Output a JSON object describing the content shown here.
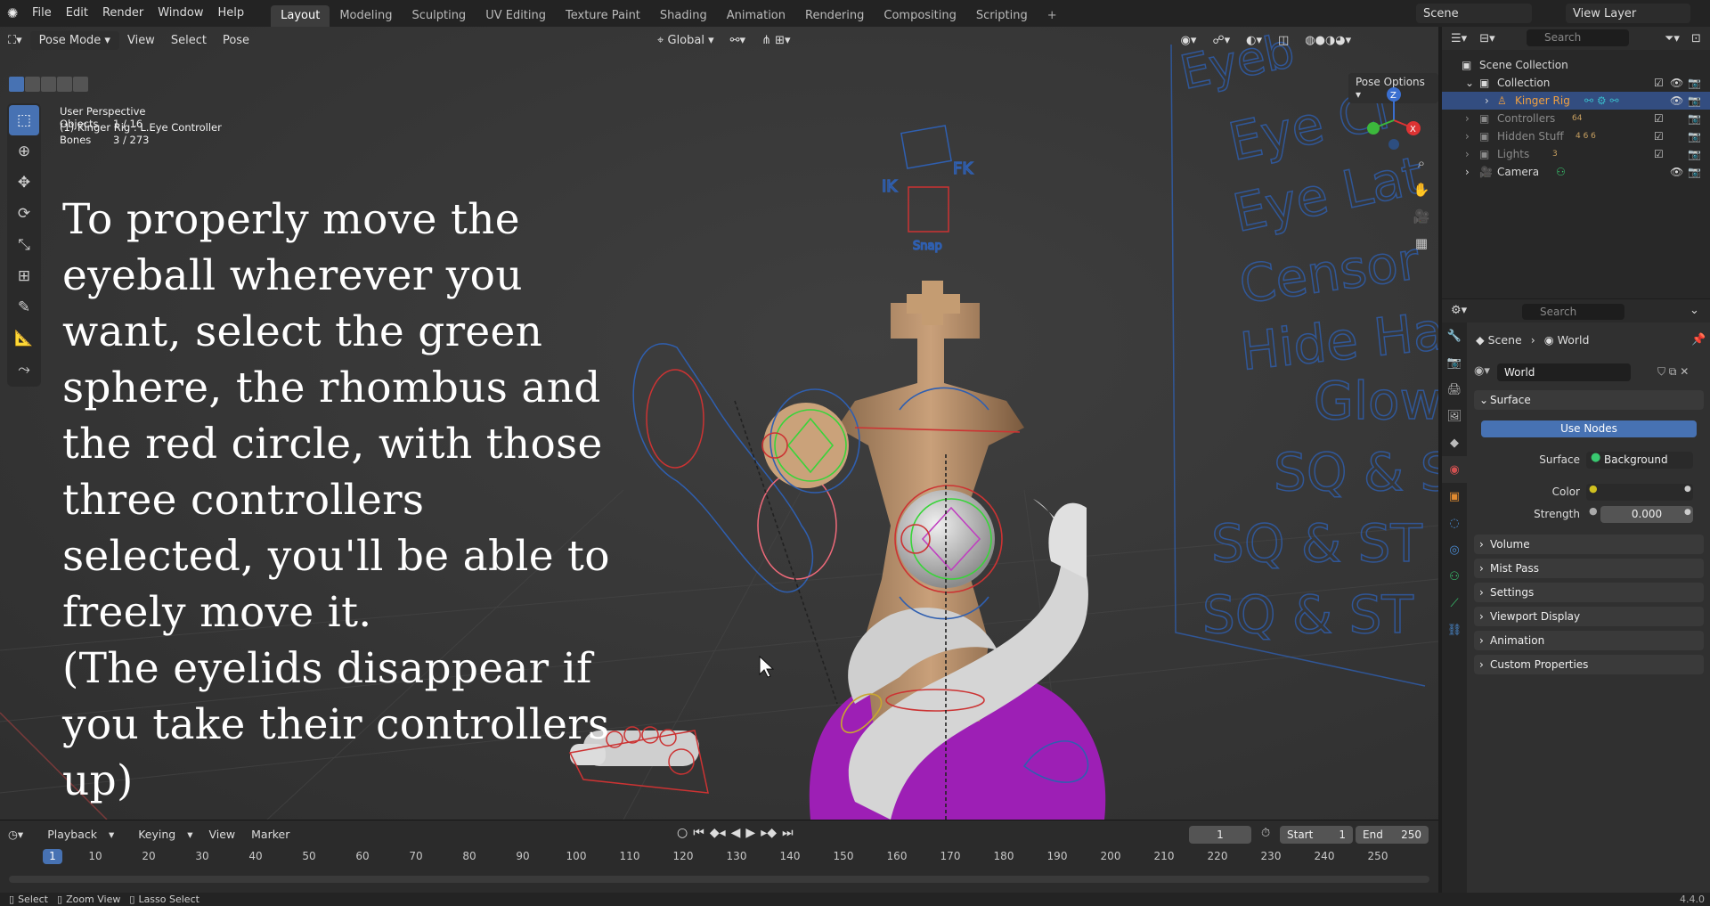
{
  "topbar": {
    "menu": [
      "File",
      "Edit",
      "Render",
      "Window",
      "Help"
    ],
    "workspaces": [
      "Layout",
      "Modeling",
      "Sculpting",
      "UV Editing",
      "Texture Paint",
      "Shading",
      "Animation",
      "Rendering",
      "Compositing",
      "Scripting"
    ],
    "active_workspace": "Layout",
    "scene": "Scene",
    "view_layer": "View Layer"
  },
  "viewport": {
    "mode": "Pose Mode",
    "menus": [
      "View",
      "Select",
      "Pose"
    ],
    "orientation": "Global",
    "pose_options": "Pose Options",
    "perspective": "User Perspective",
    "active_object": "(1) Kinger Rig : L.Eye Controller",
    "objects_label": "Objects",
    "objects_value": "1 / 16",
    "bones_label": "Bones",
    "bones_value": "3 / 273",
    "overlay_text": "To properly move the\neyeball wherever you\nwant, select the green\nsphere, the rhombus and\nthe red circle, with those\nthree controllers\nselected, you'll be able to\nfreely move it.\n(The eyelids disappear if\nyou take their controllers\nup)",
    "gizmo_axes": [
      "Z",
      "X"
    ],
    "board_labels": [
      "IK",
      "FK",
      "Snap"
    ],
    "colors": {
      "select_accent": "#4772b3",
      "bone_green": "#39d43a",
      "bone_red": "#e0303a",
      "bone_blue": "#3a6fd0",
      "purple": "#9d1fb5"
    }
  },
  "timeline": {
    "menus": [
      "Playback",
      "Keying",
      "View",
      "Marker"
    ],
    "current_frame": "1",
    "start_label": "Start",
    "start": "1",
    "end_label": "End",
    "end": "250",
    "ticks": [
      "1",
      "10",
      "20",
      "30",
      "40",
      "50",
      "60",
      "70",
      "80",
      "90",
      "100",
      "110",
      "120",
      "130",
      "140",
      "150",
      "160",
      "170",
      "180",
      "190",
      "200",
      "210",
      "220",
      "230",
      "240",
      "250"
    ]
  },
  "statusbar": {
    "select": "Select",
    "zoom": "Zoom View",
    "lasso": "Lasso Select",
    "version": "4.4.0"
  },
  "outliner": {
    "search_placeholder": "Search",
    "scene_collection": "Scene Collection",
    "items": [
      {
        "label": "Collection",
        "badge": ""
      },
      {
        "label": "Kinger Rig",
        "badge": ""
      },
      {
        "label": "Controllers",
        "badge": "64"
      },
      {
        "label": "Hidden Stuff",
        "badge": "4 6 6"
      },
      {
        "label": "Lights",
        "badge": "3"
      },
      {
        "label": "Camera",
        "badge": ""
      }
    ]
  },
  "properties": {
    "search_placeholder": "Search",
    "breadcrumb_scene": "Scene",
    "breadcrumb_world": "World",
    "world_name": "World",
    "surface_panel": "Surface",
    "use_nodes": "Use Nodes",
    "surface_label": "Surface",
    "surface_value": "Background",
    "color_label": "Color",
    "strength_label": "Strength",
    "strength_value": "0.000",
    "panels": [
      "Volume",
      "Mist Pass",
      "Settings",
      "Viewport Display",
      "Animation",
      "Custom Properties"
    ]
  }
}
